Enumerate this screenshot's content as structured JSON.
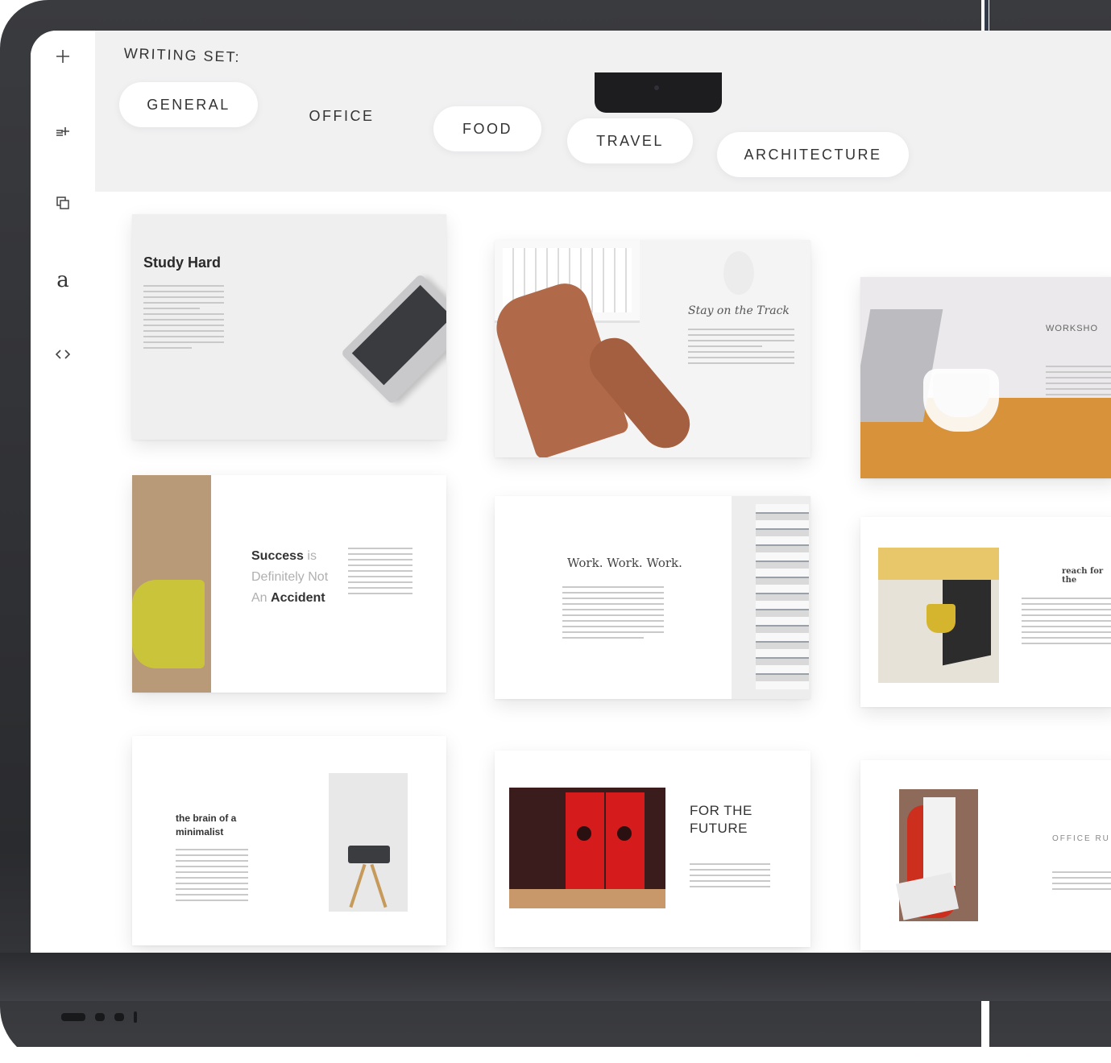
{
  "sidebar": {
    "items": [
      {
        "name": "add-icon"
      },
      {
        "name": "add-list-icon"
      },
      {
        "name": "duplicate-icon"
      },
      {
        "name": "font-icon",
        "label": "a"
      },
      {
        "name": "code-icon"
      }
    ]
  },
  "toolbar": {
    "set_label": "WRITING SET:",
    "tabs": [
      {
        "label": "GENERAL"
      },
      {
        "label": "OFFICE"
      },
      {
        "label": "FOOD"
      },
      {
        "label": "TRAVEL"
      },
      {
        "label": "ARCHITECTURE"
      }
    ]
  },
  "cards": {
    "c1": {
      "title": "Study Hard"
    },
    "c2": {
      "title": "Stay on the Track"
    },
    "c3": {
      "title": "WORKSHO"
    },
    "c4": {
      "w1": "Success",
      "w2": "is",
      "w3": "Definitely Not",
      "w4": "An",
      "w5": "Accident"
    },
    "c5": {
      "title": "Work. Work. Work."
    },
    "c6": {
      "title": "reach for the"
    },
    "c7": {
      "title_l1": "the brain of a",
      "title_l2": "minimalist"
    },
    "c8": {
      "title_l1": "FOR THE",
      "title_l2": "FUTURE"
    },
    "c9": {
      "title": "OFFICE RU"
    }
  },
  "colors": {
    "toolbar_bg": "#f1f1f2",
    "laptop_body": "#2f3034",
    "binder_red": "#d51b1b",
    "chair_yellow": "#c9c43a",
    "desk_orange": "#d8923a"
  }
}
